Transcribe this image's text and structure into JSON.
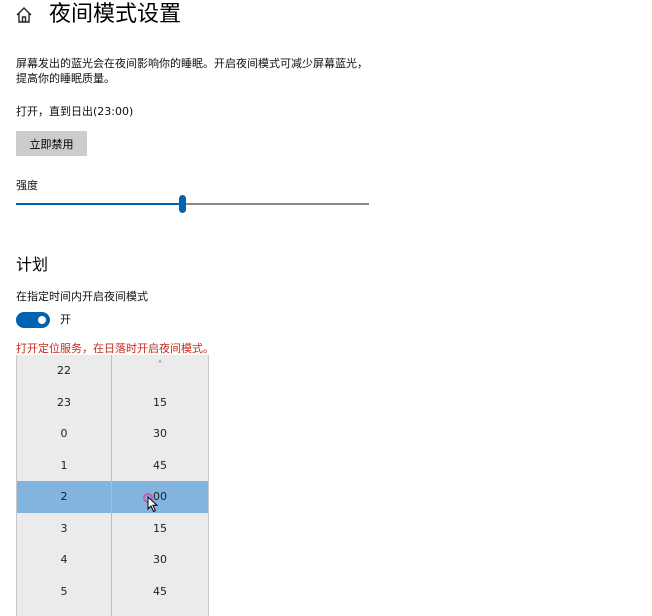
{
  "header": {
    "title": "夜间模式设置",
    "home_icon": "home-icon"
  },
  "description": "屏幕发出的蓝光会在夜间影响你的睡眠。开启夜间模式可减少屏幕蓝光，提高你的睡眠质量。",
  "status": "打开，直到日出(23:00)",
  "disable_button_label": "立即禁用",
  "strength": {
    "label": "强度",
    "value_fraction": 0.47
  },
  "schedule": {
    "heading": "计划",
    "toggle_label": "在指定时间内开启夜间模式",
    "toggle_state": "开",
    "toggle_on": true,
    "location_notice": "打开定位服务，在日落时开启夜间模式。"
  },
  "time_picker": {
    "hours": [
      "22",
      "23",
      "0",
      "1",
      "2",
      "3",
      "4",
      "5"
    ],
    "minutes": [
      "15",
      "30",
      "45",
      "00",
      "15",
      "30",
      "45"
    ],
    "selected_hour": "2",
    "selected_minute": "00"
  },
  "colors": {
    "accent": "#0063b1",
    "selection": "#83b4e0",
    "notice": "#c42b1c",
    "button": "#cccccc"
  }
}
